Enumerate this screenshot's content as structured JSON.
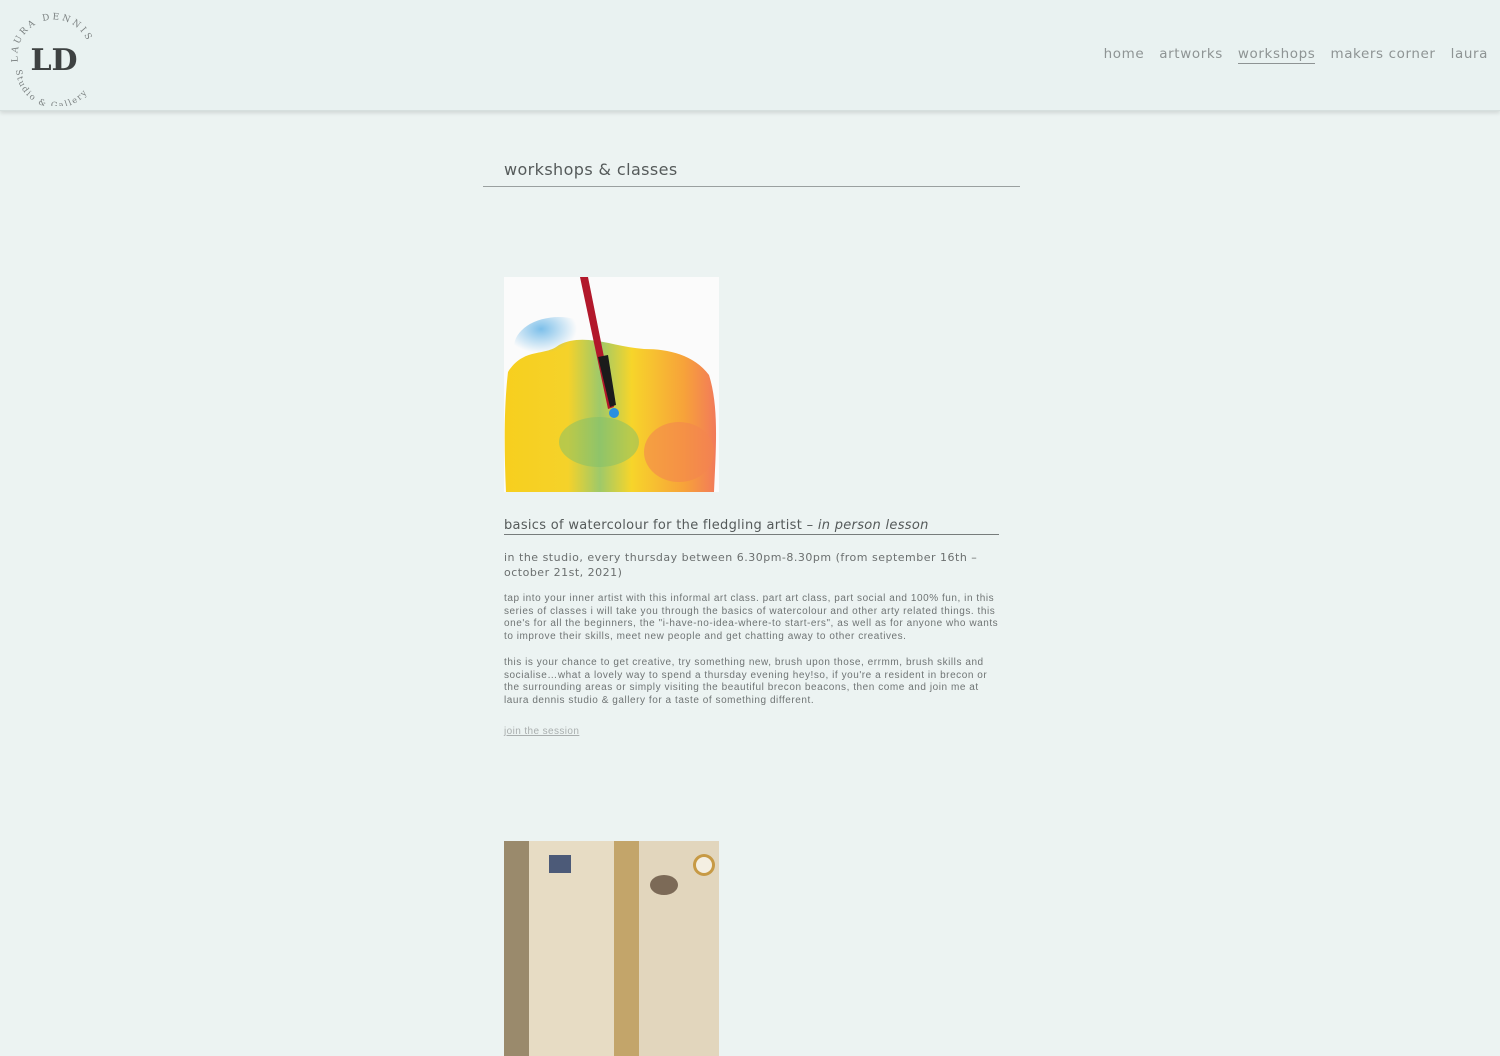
{
  "header": {
    "logo": {
      "arc_top": "LAURA DENNIS",
      "monogram": "LD",
      "arc_bottom": "Studio & Gallery"
    },
    "nav": [
      {
        "label": "home",
        "active": false
      },
      {
        "label": "artworks",
        "active": false
      },
      {
        "label": "workshops",
        "active": true
      },
      {
        "label": "makers corner",
        "active": false
      },
      {
        "label": "laura",
        "active": false
      }
    ]
  },
  "page": {
    "title": "workshops & classes"
  },
  "workshops": [
    {
      "image": "watercolour-brush-painting",
      "title": "basics of watercolour for the fledgling artist – ",
      "mode": "in person lesson",
      "when": "in the studio, every thursday between 6.30pm-8.30pm (from september 16th – october 21st, 2021)",
      "body": [
        "tap into your inner artist with this informal art class. part art class, part social and 100% fun, in this series of classes i will take you through the basics of watercolour and other arty related things. this one's for all the beginners, the \"i-have-no-idea-where-to start-ers\", as well as for anyone who wants to improve their skills, meet new people and get chatting away to other creatives.",
        "this is your chance to get creative, try something new, brush upon those, errmm, brush skills and socialise…what a lovely way to spend a thursday evening hey!so, if you're a resident in brecon or the surrounding areas or simply visiting the beautiful brecon beacons, then come and join me at laura dennis studio & gallery for a taste of something different."
      ],
      "link": "join the session"
    },
    {
      "image": "studio-interior-photo"
    }
  ],
  "colors": {
    "background": "#ecf3f2",
    "header": "#e9f2f1",
    "text": "#6b6f6f",
    "nav": "#8e9494"
  }
}
